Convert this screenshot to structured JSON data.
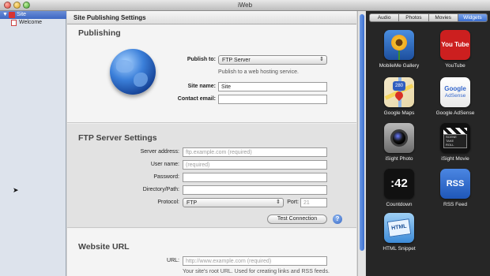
{
  "window": {
    "title": "iWeb"
  },
  "sidebar": {
    "site_label": "Site",
    "pages": [
      {
        "label": "Welcome"
      }
    ]
  },
  "main": {
    "header_title": "Site Publishing Settings",
    "publishing": {
      "title": "Publishing",
      "publish_to_label": "Publish to:",
      "publish_to_value": "FTP Server",
      "publish_hint": "Publish to a web hosting service.",
      "site_name_label": "Site name:",
      "site_name_value": "Site",
      "contact_email_label": "Contact email:",
      "contact_email_value": ""
    },
    "ftp": {
      "title": "FTP Server Settings",
      "server_address_label": "Server address:",
      "server_address_placeholder": "ftp.example.com (required)",
      "user_name_label": "User name:",
      "user_name_placeholder": "(required)",
      "password_label": "Password:",
      "password_value": "",
      "directory_label": "Directory/Path:",
      "directory_value": "",
      "protocol_label": "Protocol:",
      "protocol_value": "FTP",
      "port_label": "Port:",
      "port_value": "21",
      "test_button": "Test Connection",
      "help_icon": "?"
    },
    "website_url": {
      "title": "Website URL",
      "url_label": "URL:",
      "url_placeholder": "http://www.example.com (required)",
      "url_hint": "Your site's root URL. Used for creating links and RSS feeds."
    }
  },
  "media_browser": {
    "tabs": [
      "Audio",
      "Photos",
      "Movies",
      "Widgets"
    ],
    "active_tab": "Widgets",
    "widgets": [
      {
        "name": "MobileMe Gallery",
        "icon": "flower-icon"
      },
      {
        "name": "YouTube",
        "icon": "youtube-icon",
        "glyph": "You Tube"
      },
      {
        "name": "Google Maps",
        "icon": "maps-icon",
        "glyph": "280"
      },
      {
        "name": "Google AdSense",
        "icon": "adsense-icon",
        "glyph_1": "Google",
        "glyph_2": "AdSense"
      },
      {
        "name": "iSight Photo",
        "icon": "camera-icon"
      },
      {
        "name": "iSight Movie",
        "icon": "movie-icon"
      },
      {
        "name": "Countdown",
        "icon": "countdown-icon",
        "glyph": ":42"
      },
      {
        "name": "RSS Feed",
        "icon": "rss-icon",
        "glyph": "RSS"
      },
      {
        "name": "HTML Snippet",
        "icon": "html-icon",
        "glyph": "HTML"
      }
    ]
  }
}
